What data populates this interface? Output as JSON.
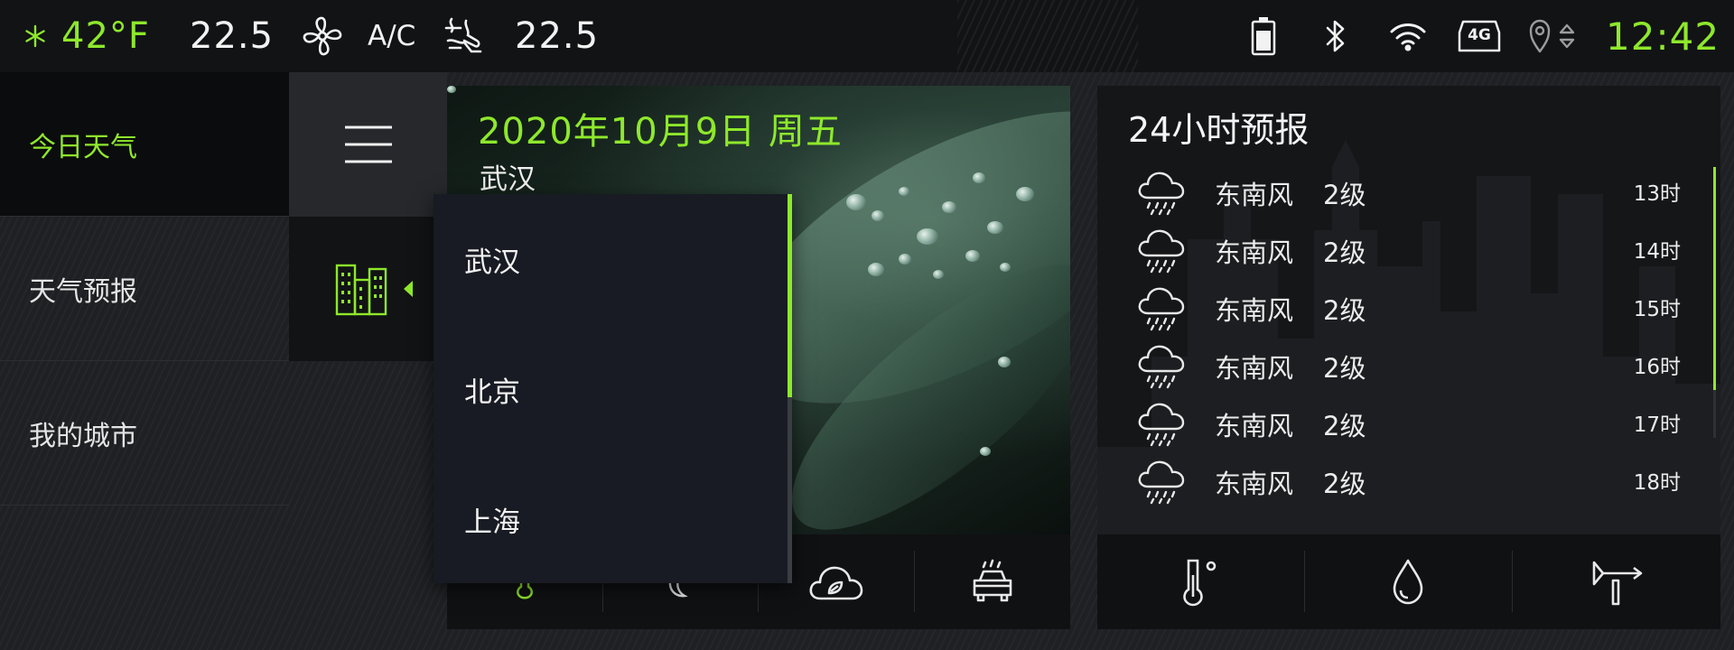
{
  "status_bar": {
    "outside_temp": "42°F",
    "left_temp": "22.5",
    "ac_label": "A/C",
    "right_temp": "22.5",
    "clock": "12:42",
    "icons": [
      "snowflake-icon",
      "fan-icon",
      "seat-airflow-icon",
      "battery-icon",
      "bluetooth-icon",
      "wifi-icon",
      "4g-icon",
      "location-icon"
    ],
    "network_label": "4G"
  },
  "sidebar": {
    "items": [
      {
        "label": "今日天气",
        "active": true
      },
      {
        "label": "天气预报",
        "active": false
      },
      {
        "label": "我的城市",
        "active": false
      }
    ]
  },
  "rail": {
    "icons": [
      "menu-icon",
      "city-buildings-icon"
    ]
  },
  "today": {
    "date": "2020年10月9日  周五",
    "city": "武汉",
    "toolbar_icons": [
      "thermometer-icon",
      "moon-icon",
      "eco-cloud-icon",
      "car-wash-icon"
    ]
  },
  "city_dropdown": {
    "options": [
      "武汉",
      "北京",
      "上海"
    ],
    "selected": "武汉"
  },
  "forecast": {
    "title": "24小时预报",
    "rows": [
      {
        "direction": "东南风",
        "level": "2级",
        "time": "13时",
        "icon": "rain-icon"
      },
      {
        "direction": "东南风",
        "level": "2级",
        "time": "14时",
        "icon": "rain-icon"
      },
      {
        "direction": "东南风",
        "level": "2级",
        "time": "15时",
        "icon": "rain-icon"
      },
      {
        "direction": "东南风",
        "level": "2级",
        "time": "16时",
        "icon": "rain-icon"
      },
      {
        "direction": "东南风",
        "level": "2级",
        "time": "17时",
        "icon": "rain-icon"
      },
      {
        "direction": "东南风",
        "level": "2级",
        "time": "18时",
        "icon": "rain-icon"
      }
    ],
    "toolbar_icons": [
      "temperature-icon",
      "humidity-drop-icon",
      "wind-vane-icon"
    ]
  },
  "colors": {
    "accent": "#8ee82b",
    "background": "#1e2023",
    "panel": "#151618",
    "dropdown": "#181b23"
  }
}
